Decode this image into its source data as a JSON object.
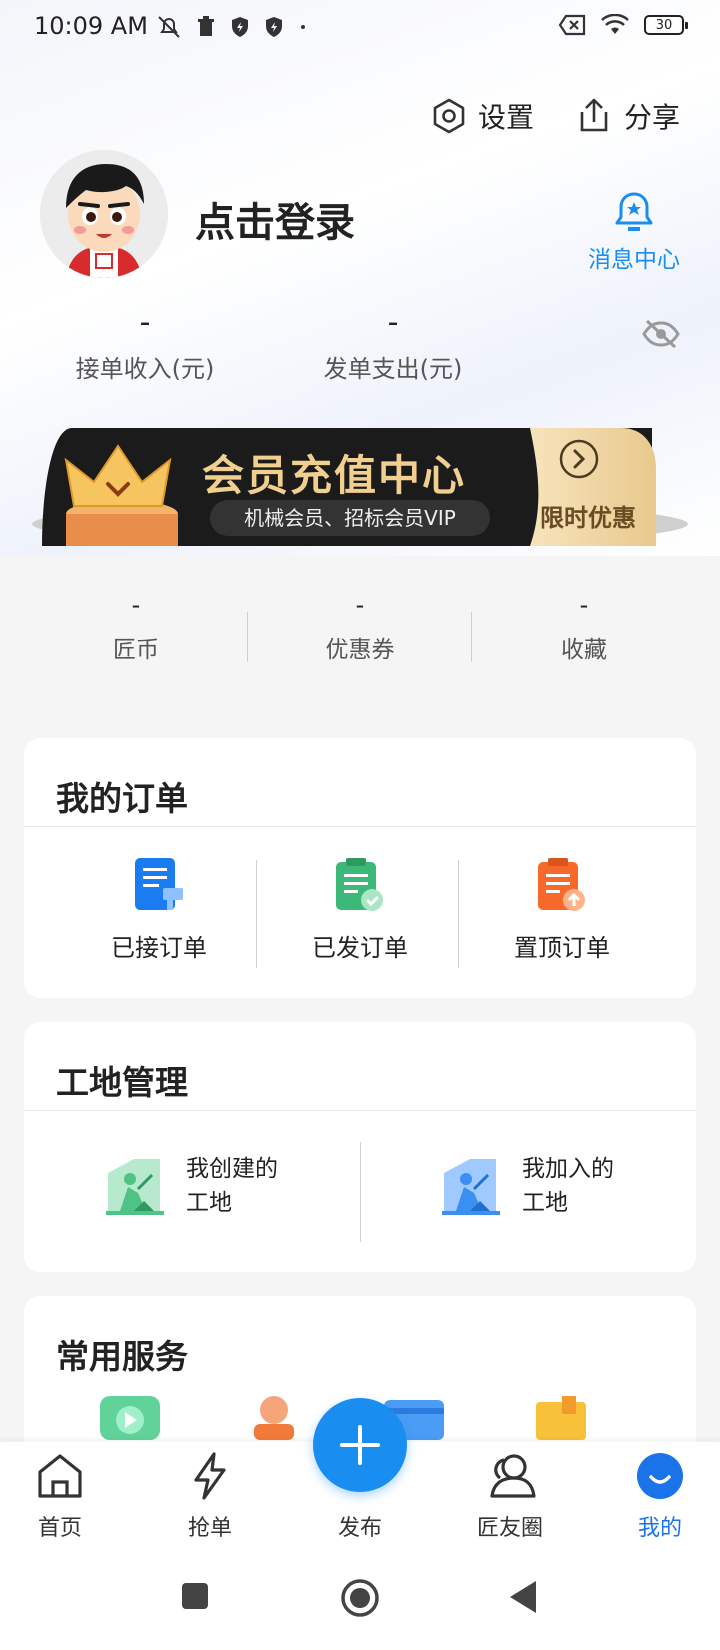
{
  "status_bar": {
    "time": "10:09 AM",
    "battery": "30"
  },
  "header": {
    "settings_label": "设置",
    "share_label": "分享"
  },
  "profile": {
    "login_text": "点击登录",
    "message_center": "消息中心"
  },
  "income_stats": [
    {
      "value": "-",
      "label": "接单收入(元)"
    },
    {
      "value": "-",
      "label": "发单支出(元)"
    }
  ],
  "vip_banner": {
    "title": "会员充值中心",
    "subtitle": "机械会员、招标会员VIP",
    "promo": "限时优惠"
  },
  "counts": [
    {
      "value": "-",
      "label": "匠币"
    },
    {
      "value": "-",
      "label": "优惠券"
    },
    {
      "value": "-",
      "label": "收藏"
    }
  ],
  "orders": {
    "title": "我的订单",
    "items": [
      {
        "label": "已接订单",
        "icon": "received-order-icon",
        "color": "#1a7cf0"
      },
      {
        "label": "已发订单",
        "icon": "sent-order-icon",
        "color": "#3cb878"
      },
      {
        "label": "置顶订单",
        "icon": "pinned-order-icon",
        "color": "#f7692a"
      }
    ]
  },
  "sites": {
    "title": "工地管理",
    "items": [
      {
        "line1": "我创建的",
        "line2": "工地",
        "icon": "created-site-icon",
        "color": "#4fc286"
      },
      {
        "line1": "我加入的",
        "line2": "工地",
        "icon": "joined-site-icon",
        "color": "#3a8ff0"
      }
    ]
  },
  "services": {
    "title": "常用服务"
  },
  "bottom_nav": [
    {
      "label": "首页",
      "icon": "home-icon"
    },
    {
      "label": "抢单",
      "icon": "lightning-icon"
    },
    {
      "label": "发布",
      "icon": "plus-icon"
    },
    {
      "label": "匠友圈",
      "icon": "friends-icon"
    },
    {
      "label": "我的",
      "icon": "profile-icon"
    }
  ],
  "colors": {
    "accent": "#1a8ef0",
    "active_nav": "#1a73e8"
  }
}
